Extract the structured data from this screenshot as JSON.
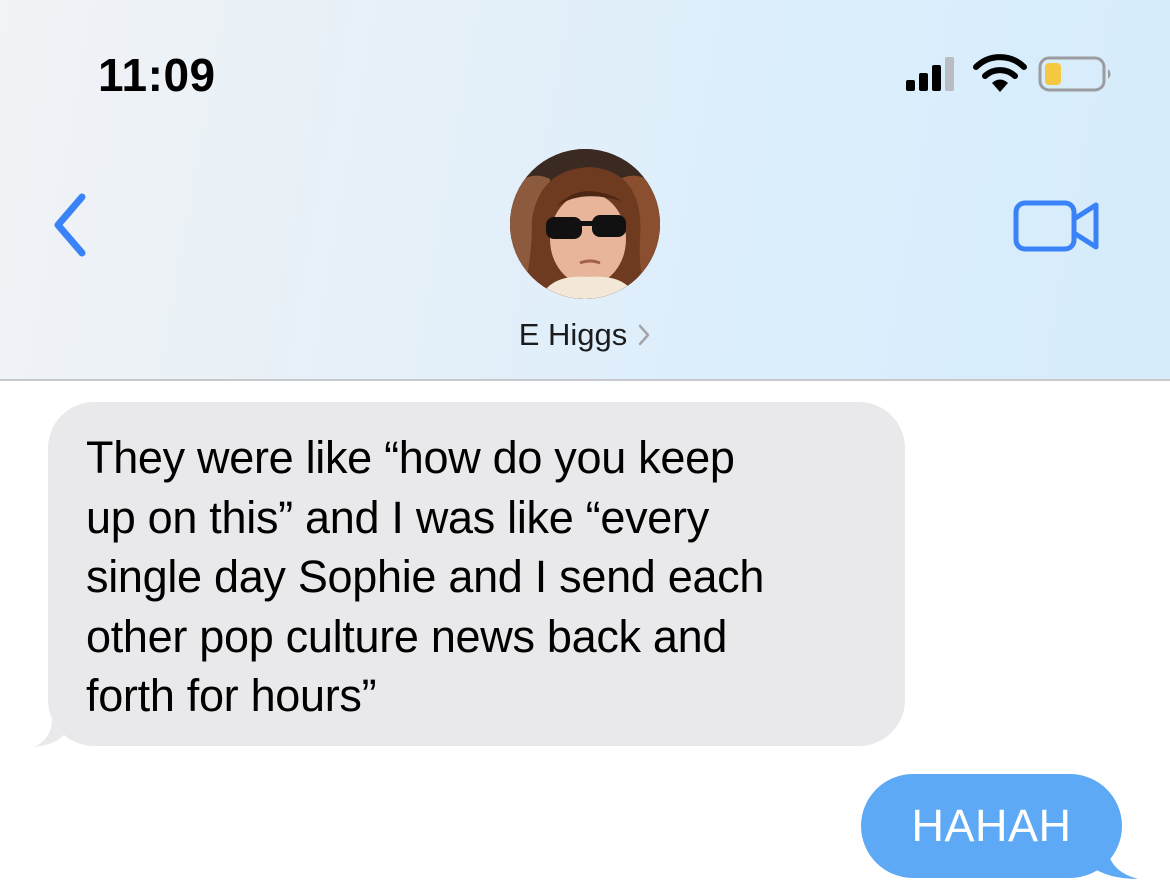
{
  "status_bar": {
    "time": "11:09",
    "icons": [
      "cell-signal-icon",
      "wifi-icon",
      "battery-icon"
    ],
    "battery_level": 0.3,
    "battery_color": "#f5c842"
  },
  "header": {
    "back_icon": "chevron-left-icon",
    "contact_name": "E Higgs",
    "video_icon": "video-camera-icon",
    "accent_color": "#3a82f7"
  },
  "messages": [
    {
      "direction": "incoming",
      "lines": [
        "They were like “how do you keep",
        "up on this” and I was like “every",
        "single day Sophie and I send each",
        "other pop culture news back and",
        "forth for hours”"
      ]
    },
    {
      "direction": "outgoing",
      "text": "HAHAH"
    }
  ],
  "colors": {
    "incoming_bubble": "#e9e9eb",
    "outgoing_bubble": "#5da9f5"
  }
}
